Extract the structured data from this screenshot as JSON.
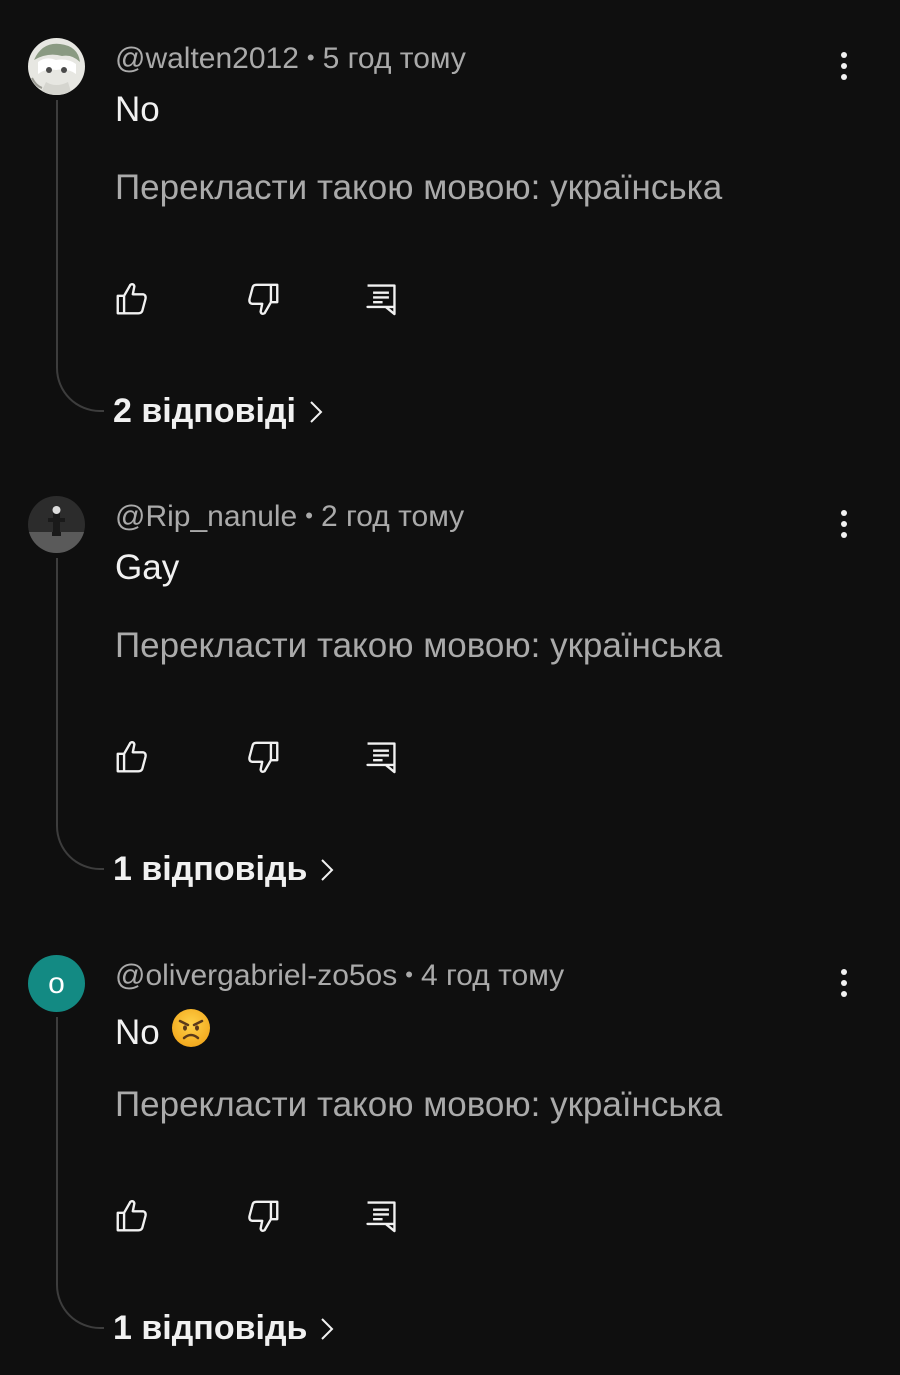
{
  "comments": [
    {
      "author": "@walten2012",
      "separator": "•",
      "time": "5 год тому",
      "text": "No",
      "translate": "Перекласти такою мовою: українська",
      "replies": "2 відповіді",
      "avatar": "anime-character-avatar"
    },
    {
      "author": "@Rip_nanule",
      "separator": "•",
      "time": "2 год тому",
      "text": "Gay",
      "translate": "Перекласти такою мовою: українська",
      "replies": "1 відповідь",
      "avatar": "dark-figure-avatar"
    },
    {
      "author": "@olivergabriel-zo5os",
      "separator": "•",
      "time": "4 год тому",
      "text": "No",
      "emoji": "angry-face",
      "translate": "Перекласти такою мовою: українська",
      "replies": "1 відповідь",
      "avatar_letter": "o",
      "avatar_color": "#138a83"
    }
  ],
  "colors": {
    "background": "#0f0f0f",
    "primary_text": "#f1f1f1",
    "secondary_text": "#aaaaaa",
    "thread_line": "#3d3d3d"
  },
  "icons": [
    "thumbs-up-icon",
    "thumbs-down-icon",
    "reply-icon",
    "more-vert-icon",
    "chevron-right-icon"
  ]
}
